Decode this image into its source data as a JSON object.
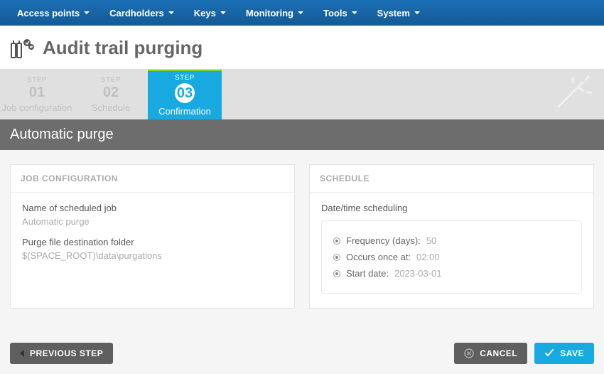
{
  "nav": {
    "items": [
      "Access points",
      "Cardholders",
      "Keys",
      "Monitoring",
      "Tools",
      "System"
    ]
  },
  "page_title": "Audit trail purging",
  "steps": [
    {
      "label": "STEP",
      "num": "01",
      "name": "Job configuration"
    },
    {
      "label": "STEP",
      "num": "02",
      "name": "Schedule"
    },
    {
      "label": "STEP",
      "num": "03",
      "name": "Confirmation"
    }
  ],
  "active_step_index": 2,
  "subheader": "Automatic purge",
  "job_panel": {
    "header": "JOB CONFIGURATION",
    "name_label": "Name of scheduled job",
    "name_value": "Automatic purge",
    "folder_label": "Purge file destination folder",
    "folder_value": "$(SPACE_ROOT)\\data\\purgations"
  },
  "schedule_panel": {
    "header": "SCHEDULE",
    "group_label": "Date/time scheduling",
    "rows": [
      {
        "label": "Frequency (days):",
        "value": "50"
      },
      {
        "label": "Occurs once at:",
        "value": "02:00"
      },
      {
        "label": "Start date:",
        "value": "2023-03-01"
      }
    ]
  },
  "buttons": {
    "previous": "PREVIOUS STEP",
    "cancel": "CANCEL",
    "save": "SAVE"
  }
}
